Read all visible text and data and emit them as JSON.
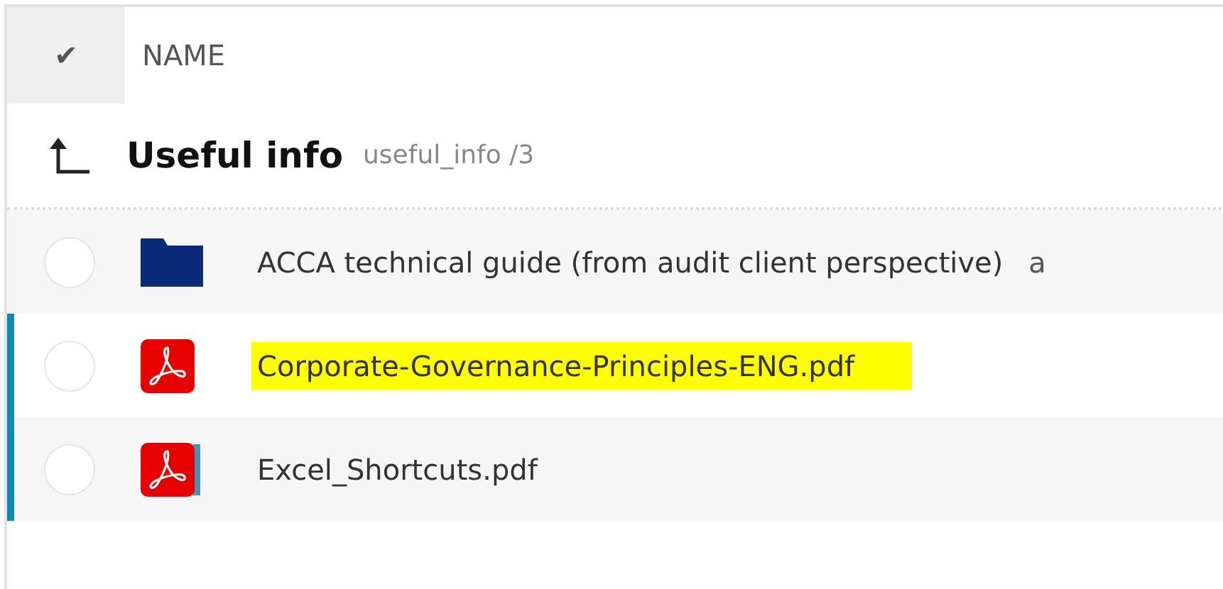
{
  "header": {
    "check_all": "✔",
    "column": "NAME"
  },
  "folder": {
    "title": "Useful info",
    "path": "useful_info /3"
  },
  "rows": [
    {
      "kind": "folder",
      "name": "ACCA technical guide (from audit client perspective)",
      "column_2": "a",
      "checked": false,
      "marked": false,
      "highlighted": false
    },
    {
      "kind": "pdf",
      "name": "Corporate-Governance-Principles-ENG.pdf",
      "checked": false,
      "marked": true,
      "highlighted": true
    },
    {
      "kind": "pdf-stack",
      "name": "Excel_Shortcuts.pdf",
      "checked": false,
      "marked": true,
      "highlighted": false
    }
  ]
}
